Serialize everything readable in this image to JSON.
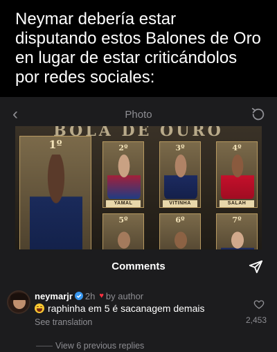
{
  "caption": {
    "text": "Neymar debería estar disputando estos Balones de Oro en lugar de estar criticándolos por redes sociales:"
  },
  "photo_header": {
    "title": "Photo",
    "back_icon": "chevron-left-icon",
    "rotate_icon": "rotate-icon"
  },
  "poster": {
    "title": "BOLA DE OURO",
    "cards": [
      {
        "rank": "1º",
        "name": ""
      },
      {
        "rank": "2º",
        "name": "YAMAL"
      },
      {
        "rank": "3º",
        "name": "VITINHA"
      },
      {
        "rank": "4º",
        "name": "SALAH"
      },
      {
        "rank": "5º",
        "name": ""
      },
      {
        "rank": "6º",
        "name": ""
      },
      {
        "rank": "7º",
        "name": ""
      }
    ]
  },
  "comments": {
    "title": "Comments",
    "send_icon": "send-icon",
    "items": [
      {
        "username": "neymarjr",
        "verified": true,
        "time": "2h",
        "liked_by": "by author",
        "text": "raphinha em 5 é sacanagem demais",
        "see_translation": "See translation",
        "likes": "2,453",
        "view_replies": "View 6 previous replies"
      }
    ]
  },
  "colors": {
    "background": "#000000",
    "sheet": "#1c1c1e",
    "text": "#ffffff",
    "muted": "#8e8e93",
    "heart": "#ff3040",
    "verified": "#3897f0",
    "gold": "#b89a61"
  }
}
